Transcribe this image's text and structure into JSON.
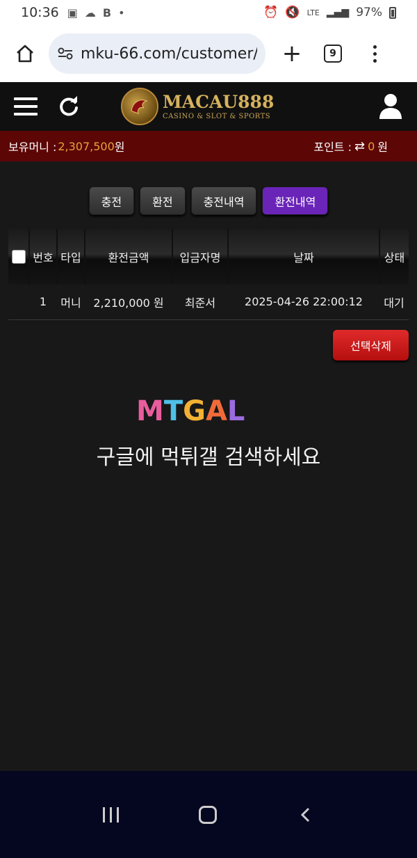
{
  "status_bar": {
    "time": "10:36",
    "battery": "97%",
    "network": "LTE"
  },
  "browser": {
    "url": "mku-66.com/customer/",
    "tab_count": "9"
  },
  "site": {
    "logo_title": "MACAU888",
    "logo_subtitle": "CASINO & SLOT & SPORTS"
  },
  "money_bar": {
    "balance_label": "보유머니 : ",
    "balance_value": "2,307,500",
    "balance_unit": " 원",
    "points_label": "포인트 : ",
    "points_value": "0",
    "points_unit": "원"
  },
  "tabs": [
    {
      "label": "충전",
      "active": false
    },
    {
      "label": "환전",
      "active": false
    },
    {
      "label": "충전내역",
      "active": false
    },
    {
      "label": "환전내역",
      "active": true
    }
  ],
  "table": {
    "headers": [
      "번호",
      "타입",
      "환전금액",
      "입금자명",
      "날짜",
      "상태"
    ],
    "rows": [
      {
        "no": "1",
        "type": "머니",
        "amount": "2,210,000 원",
        "name": "최준서",
        "date": "2025-04-26 22:00:12",
        "status": "대기"
      }
    ]
  },
  "delete_button": "선택삭제",
  "watermark": {
    "logo_letters": [
      "M",
      "T",
      "G",
      "A",
      "L"
    ],
    "text": "구글에 먹튀갤 검색하세요"
  },
  "colors": {
    "accent_purple": "#6a24b8",
    "money_bar": "#5c0606",
    "delete_red": "#c81a1a",
    "value_orange": "#e8a33a"
  }
}
